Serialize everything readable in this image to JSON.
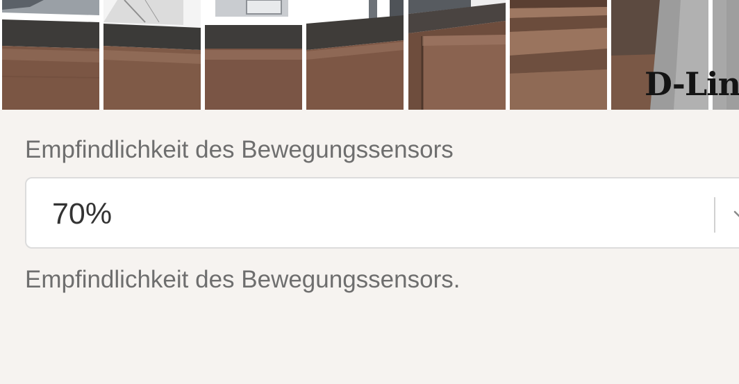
{
  "camera_preview": {
    "tile_count": 8,
    "watermark_text": "D-Link"
  },
  "motion_sensitivity": {
    "label": "Empfindlichkeit des Bewegungssensors",
    "selected_value": "70%",
    "help_text": "Empfindlichkeit des Bewegungssensors.",
    "icon": "chevron-down-icon"
  },
  "colors": {
    "background": "#f6f3f0",
    "label_text": "#6e6e6e",
    "value_text": "#333333",
    "field_border": "#dcdcdc"
  }
}
